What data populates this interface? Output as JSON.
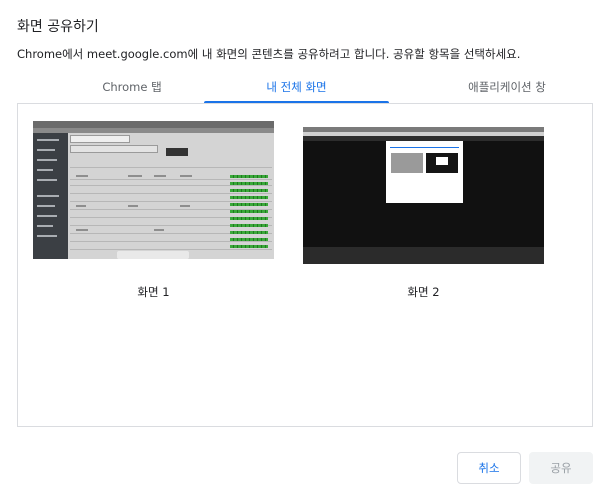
{
  "dialog": {
    "title": "화면 공유하기",
    "description": "Chrome에서 meet.google.com에 내 화면의 콘텐츠를 공유하려고 합니다. 공유할 항목을 선택하세요."
  },
  "tabs": [
    {
      "label": "Chrome 탭",
      "selected": false
    },
    {
      "label": "내 전체 화면",
      "selected": true
    },
    {
      "label": "애플리케이션 창",
      "selected": false
    }
  ],
  "screens": [
    {
      "label": "화면 1"
    },
    {
      "label": "화면 2"
    }
  ],
  "buttons": {
    "cancel": "취소",
    "share": "공유"
  },
  "colors": {
    "accent": "#1a73e8",
    "disabled_text": "#9aa0a6",
    "border": "#dadce0"
  }
}
